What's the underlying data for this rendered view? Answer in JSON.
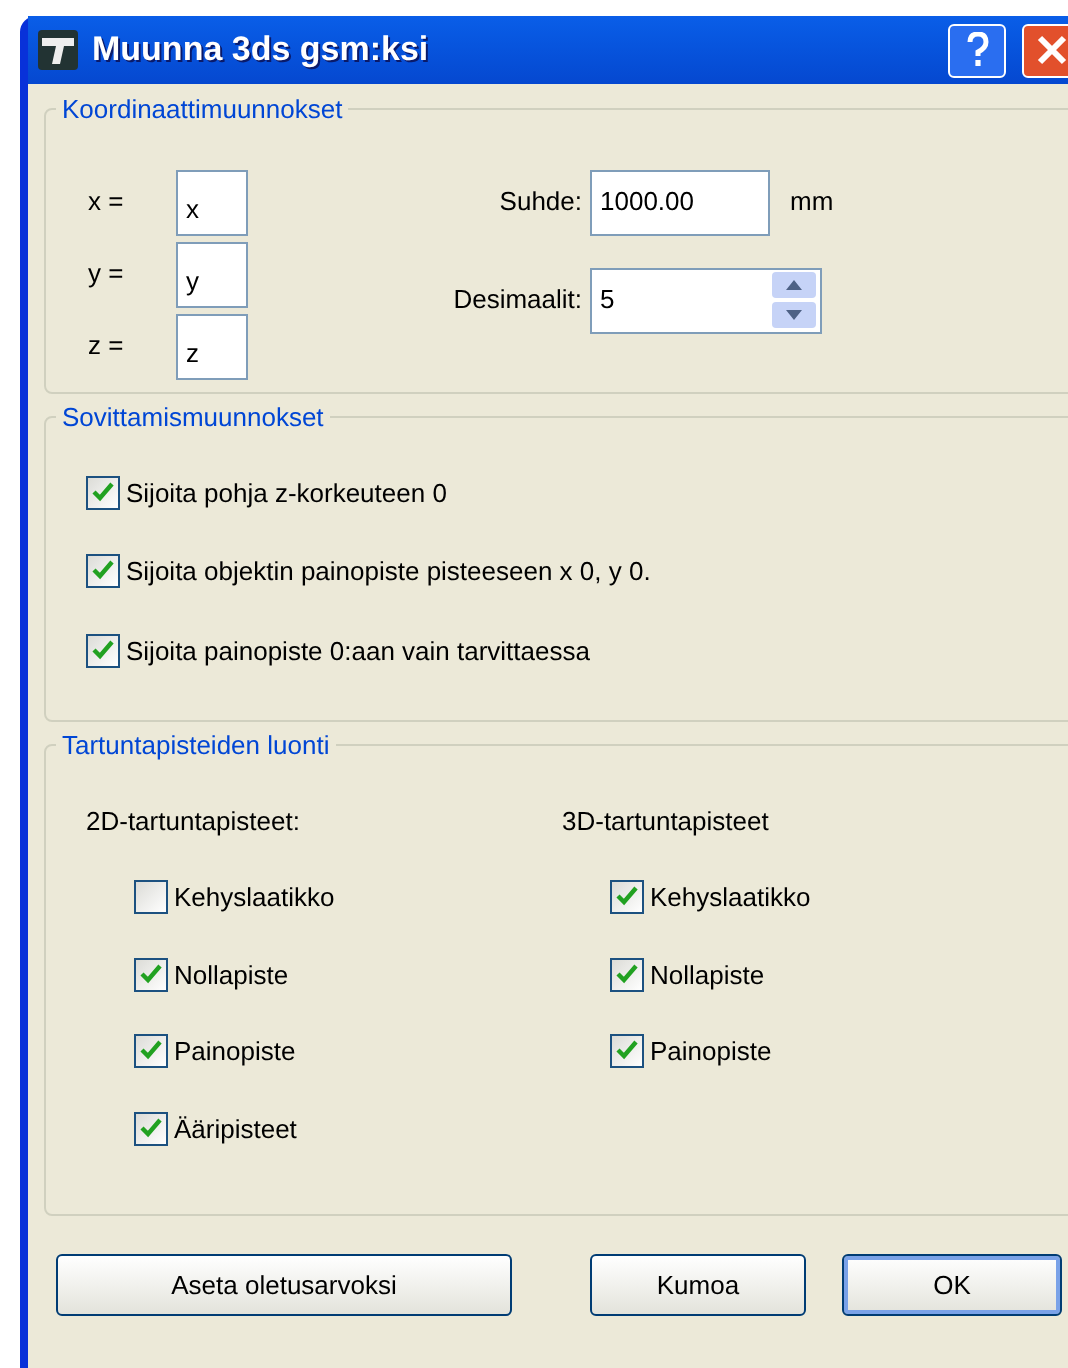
{
  "window": {
    "title": "Muunna 3ds gsm:ksi"
  },
  "coordinates": {
    "title": "Koordinaattimuunnokset",
    "axes": [
      {
        "label": "x =",
        "value": "x"
      },
      {
        "label": "y =",
        "value": "y"
      },
      {
        "label": "z =",
        "value": "z"
      }
    ],
    "ratio": {
      "label": "Suhde:",
      "value": "1000.00",
      "unit": "mm"
    },
    "decimals": {
      "label": "Desimaalit:",
      "value": "5"
    }
  },
  "fitting": {
    "title": "Sovittamismuunnokset",
    "options": [
      {
        "label": "Sijoita pohja z-korkeuteen 0",
        "checked": true
      },
      {
        "label": "Sijoita objektin painopiste pisteeseen x 0, y 0.",
        "checked": true
      },
      {
        "label": "Sijoita painopiste 0:aan vain tarvittaessa",
        "checked": true
      }
    ]
  },
  "snap_points": {
    "title": "Tartuntapisteiden luonti",
    "columns": [
      {
        "heading": "2D-tartuntapisteet:",
        "options": [
          {
            "label": "Kehyslaatikko",
            "checked": false
          },
          {
            "label": "Nollapiste",
            "checked": true
          },
          {
            "label": "Painopiste",
            "checked": true
          },
          {
            "label": "Ääripisteet",
            "checked": true
          }
        ]
      },
      {
        "heading": "3D-tartuntapisteet",
        "options": [
          {
            "label": "Kehyslaatikko",
            "checked": true
          },
          {
            "label": "Nollapiste",
            "checked": true
          },
          {
            "label": "Painopiste",
            "checked": true
          }
        ]
      }
    ]
  },
  "buttons": [
    {
      "label": "Aseta oletusarvoksi",
      "kind": "reset"
    },
    {
      "label": "Kumoa",
      "kind": "cancel"
    },
    {
      "label": "OK",
      "kind": "ok"
    }
  ]
}
